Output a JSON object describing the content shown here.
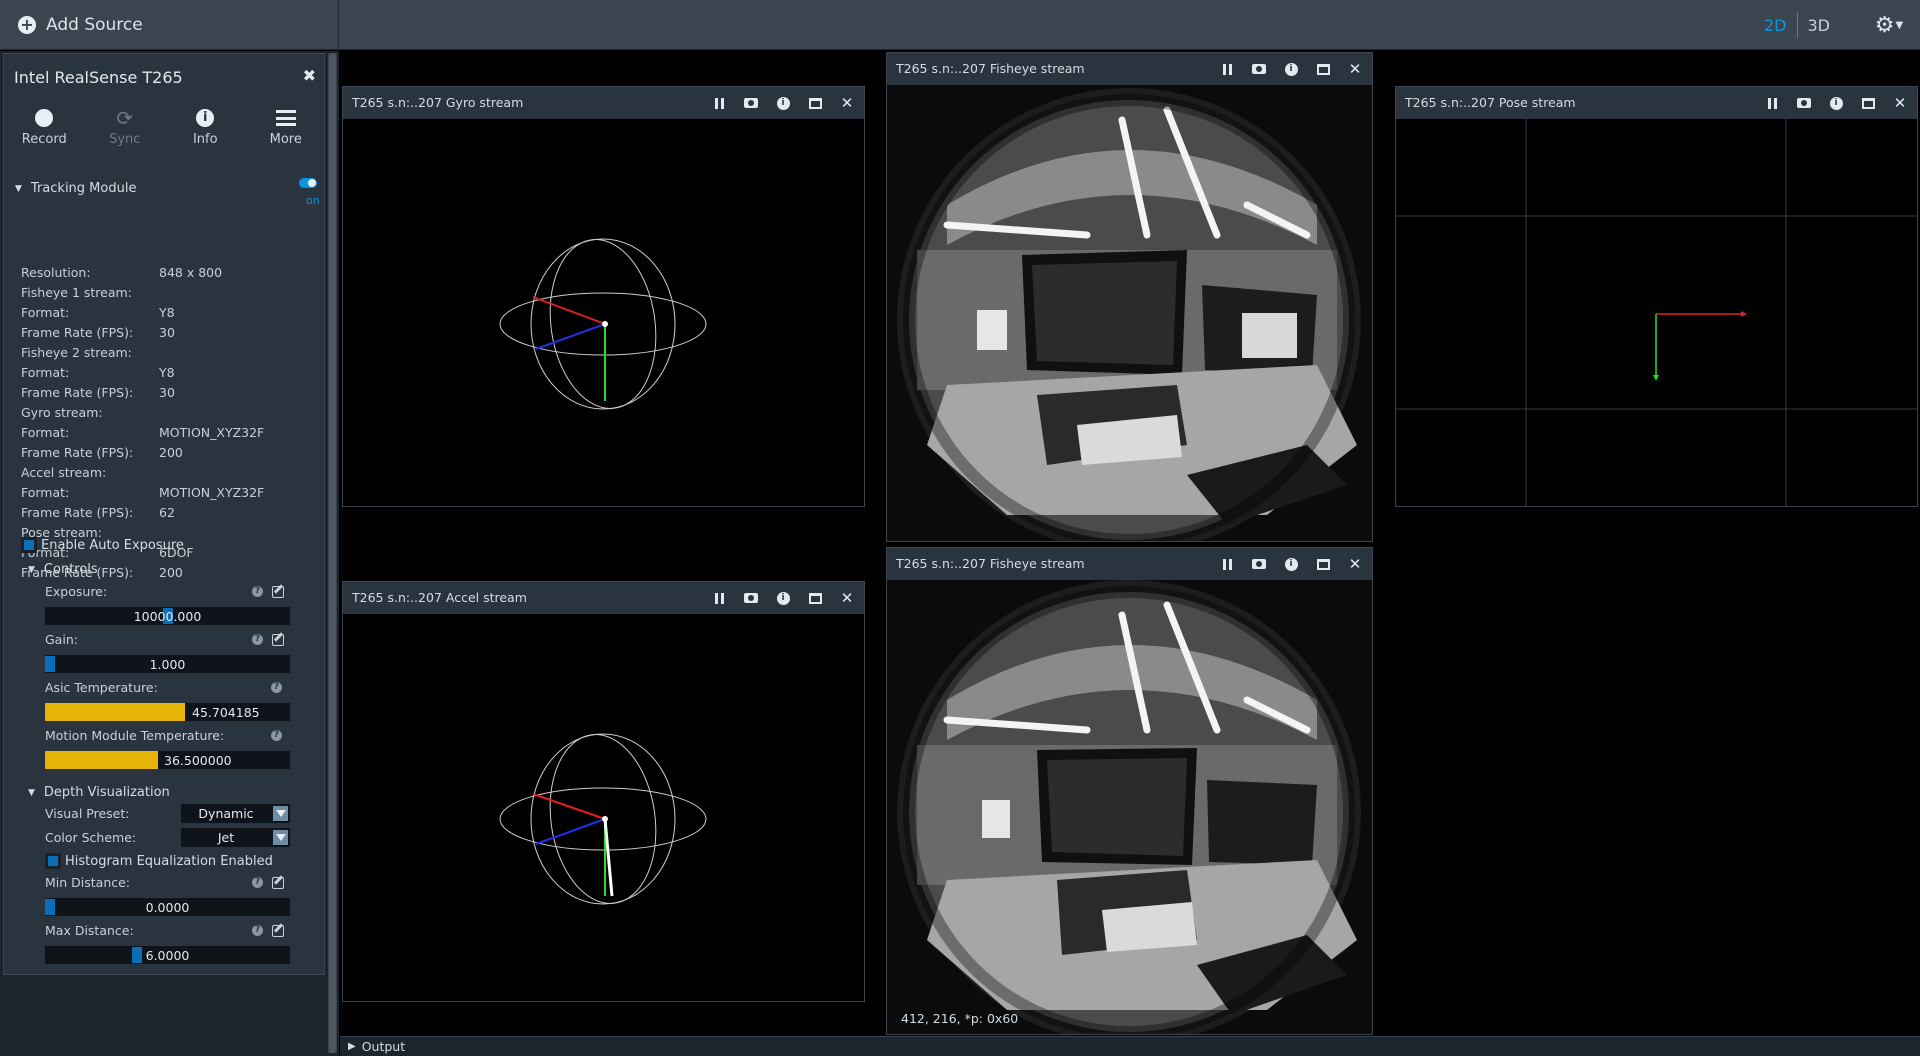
{
  "topbar": {
    "add_source_label": "Add Source",
    "view_2d": "2D",
    "view_3d": "3D",
    "accent_color": "#0a96de"
  },
  "panel": {
    "title": "Intel RealSense T265",
    "tools": [
      {
        "label": "Record",
        "icon": "record-icon",
        "enabled": true
      },
      {
        "label": "Sync",
        "icon": "sync-icon",
        "enabled": false
      },
      {
        "label": "Info",
        "icon": "info-icon",
        "enabled": true
      },
      {
        "label": "More",
        "icon": "menu-icon",
        "enabled": true
      }
    ],
    "tracking_module": {
      "label": "Tracking Module",
      "toggle_label": "on",
      "properties": [
        {
          "k": "Resolution:",
          "v": "848 x 800"
        },
        {
          "k": "Fisheye 1 stream:",
          "v": ""
        },
        {
          "k": "Format:",
          "v": "Y8"
        },
        {
          "k": "Frame Rate (FPS):",
          "v": "30"
        },
        {
          "k": "Fisheye 2 stream:",
          "v": ""
        },
        {
          "k": "Format:",
          "v": "Y8"
        },
        {
          "k": "Frame Rate (FPS):",
          "v": "30"
        },
        {
          "k": "Gyro stream:",
          "v": ""
        },
        {
          "k": "Format:",
          "v": "MOTION_XYZ32F"
        },
        {
          "k": "Frame Rate (FPS):",
          "v": "200"
        },
        {
          "k": "Accel stream:",
          "v": ""
        },
        {
          "k": "Format:",
          "v": "MOTION_XYZ32F"
        },
        {
          "k": "Frame Rate (FPS):",
          "v": "62"
        },
        {
          "k": "Pose stream:",
          "v": ""
        },
        {
          "k": "Format:",
          "v": "6DOF"
        },
        {
          "k": "Frame Rate (FPS):",
          "v": "200"
        }
      ],
      "auto_exposure_label": "Enable Auto Exposure"
    },
    "controls": {
      "label": "Controls",
      "exposure": {
        "label": "Exposure:",
        "value": "10000.000",
        "fraction": 0.5
      },
      "gain": {
        "label": "Gain:",
        "value": "1.000",
        "fraction": 0.0
      },
      "asic_temp": {
        "label": "Asic Temperature:",
        "value": "45.704185",
        "fraction": 0.57
      },
      "motion_temp": {
        "label": "Motion Module Temperature:",
        "value": "36.500000",
        "fraction": 0.46
      }
    },
    "depth_viz": {
      "label": "Depth Visualization",
      "visual_preset_label": "Visual Preset:",
      "visual_preset_value": "Dynamic",
      "color_scheme_label": "Color Scheme:",
      "color_scheme_value": "Jet",
      "histogram_label": "Histogram Equalization Enabled",
      "min_distance": {
        "label": "Min Distance:",
        "value": "0.0000",
        "fraction": 0.0
      },
      "max_distance": {
        "label": "Max Distance:",
        "value": "6.0000",
        "fraction": 0.37
      }
    }
  },
  "streams": {
    "gyro_title": "T265 s.n:..207 Gyro stream",
    "accel_title": "T265 s.n:..207 Accel stream",
    "fisheye1_title": "T265 s.n:..207 Fisheye stream",
    "fisheye2_title": "T265 s.n:..207 Fisheye stream",
    "pose_title": "T265 s.n:..207 Pose stream",
    "pixel_readout": "412, 216, *p: 0x60"
  },
  "output_label": "Output"
}
